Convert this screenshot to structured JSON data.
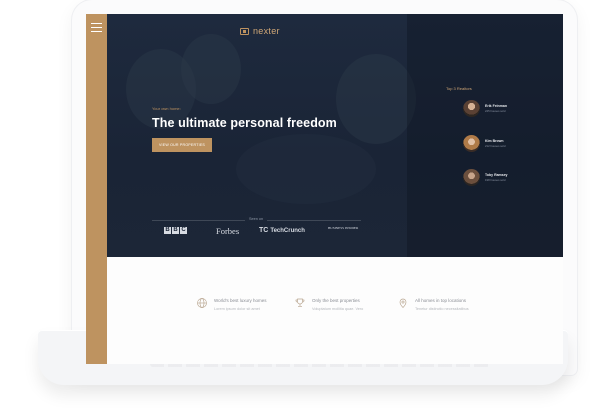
{
  "brand": {
    "name": "nexter",
    "accent": "#be9360",
    "dark": "#1c2637"
  },
  "hero": {
    "eyebrow": "Your own home:",
    "headline": "The ultimate personal freedom",
    "cta_label": "VIEW OUR PROPERTIES",
    "seen_on_label": "Seen on",
    "press": {
      "bbc": [
        "B",
        "B",
        "C"
      ],
      "forbes": "Forbes",
      "techcrunch_mark": "TC",
      "techcrunch": "TechCrunch",
      "business_insider": "BUSINESS INSIDER"
    }
  },
  "realtors": {
    "title": "Top 3 Realtors",
    "items": [
      {
        "name": "Erik Feinman",
        "role": "245 houses sold"
      },
      {
        "name": "Kim Brown",
        "role": "212 houses sold"
      },
      {
        "name": "Toby Ramsey",
        "role": "198 houses sold"
      }
    ]
  },
  "features": [
    {
      "icon": "globe-icon",
      "title": "World's best luxury homes",
      "text": "Lorem ipsum dolor sit amet"
    },
    {
      "icon": "trophy-icon",
      "title": "Only the best properties",
      "text": "Voluptatum mollitia quae. Vero"
    },
    {
      "icon": "map-pin-icon",
      "title": "All homes in top locations",
      "text": "Tenetur distinctio necessitatibus"
    }
  ]
}
